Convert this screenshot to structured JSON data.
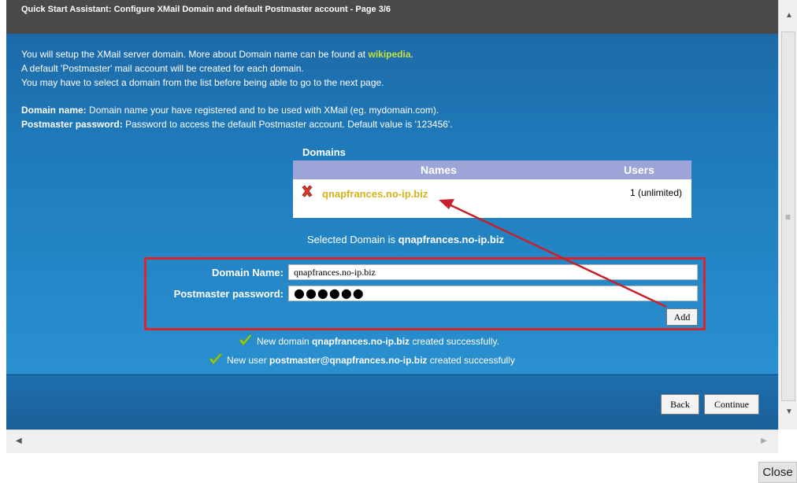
{
  "dialog": {
    "title": "Quick Start Assistant: Configure XMail Domain and default Postmaster account - Page 3/6"
  },
  "intro": {
    "line1_text": "You will setup the XMail server domain. More about Domain name can be found at",
    "line1_link": "wikipedia",
    "line1_end": ".",
    "line2": "A default 'Postmaster' mail account will be created for each domain.",
    "line3": "You may have to select a domain from the list before being able to go to the next page."
  },
  "help": {
    "domain_label": "Domain name:",
    "domain_text": "Domain name your have registered and to be used with XMail (eg. mydomain.com).",
    "password_label": "Postmaster password:",
    "password_text": "Password to access the default Postmaster account. Default value is '123456'."
  },
  "domains": {
    "section_label": "Domains",
    "col_names": "Names",
    "col_users": "Users",
    "rows": [
      {
        "name": "qnapfrances.no-ip.biz",
        "users": "1 (unlimited)"
      }
    ]
  },
  "selected": {
    "prefix": "Selected Domain is",
    "domain": "qnapfrances.no-ip.biz"
  },
  "form": {
    "domain_label": "Domain Name:",
    "domain_value": "qnapfrances.no-ip.biz",
    "password_label": "Postmaster password:",
    "password_value": "●●●●●●",
    "add_label": "Add"
  },
  "messages": {
    "domain_created_prefix": "New domain",
    "domain_created_name": "qnapfrances.no-ip.biz",
    "domain_created_suffix": "created successfully.",
    "user_created_prefix": "New user",
    "user_created_name": "postmaster@qnapfrances.no-ip.biz",
    "user_created_suffix": "created successfully"
  },
  "buttons": {
    "back": "Back",
    "continue": "Continue",
    "close": "Close"
  },
  "colors": {
    "panel_blue": "#1f7fc0",
    "link_green": "#c6e33a",
    "domain_yellow": "#d7b218",
    "highlight_red": "#d8262f",
    "table_header": "#9da4d8"
  },
  "icons": [
    "delete-x-icon",
    "checkmark-icon",
    "scroll-up-arrow-icon",
    "scroll-down-arrow-icon",
    "scroll-left-arrow-icon",
    "scroll-right-arrow-icon"
  ]
}
